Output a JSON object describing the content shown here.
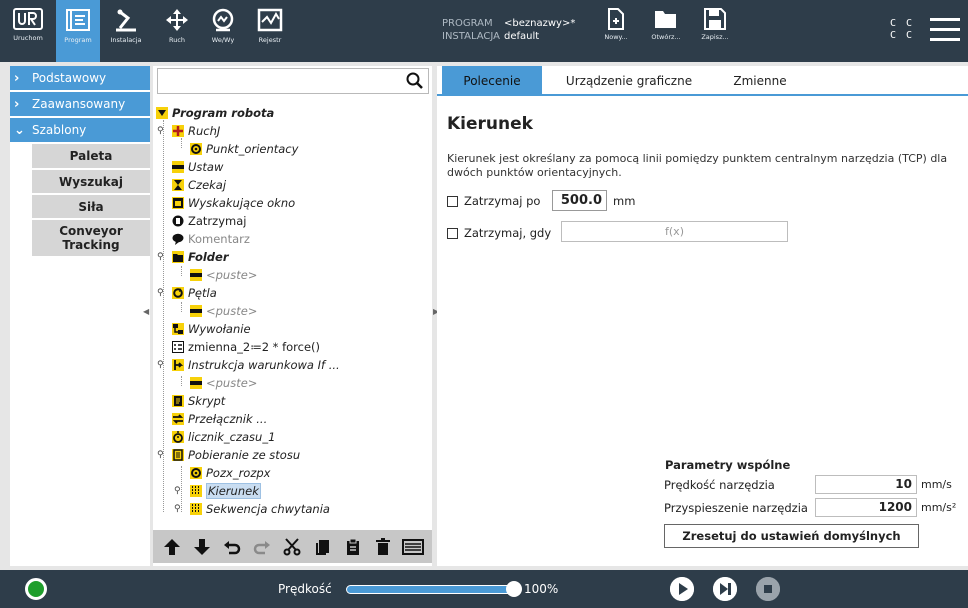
{
  "topbar": {
    "buttons": [
      {
        "label": "Uruchom",
        "icon": "ur-logo-icon"
      },
      {
        "label": "Program",
        "icon": "program-icon",
        "active": true
      },
      {
        "label": "Instalacja",
        "icon": "installation-icon"
      },
      {
        "label": "Ruch",
        "icon": "move-icon"
      },
      {
        "label": "We/Wy",
        "icon": "io-icon"
      },
      {
        "label": "Rejestr",
        "icon": "log-icon"
      }
    ],
    "program_key": "PROGRAM",
    "program_value": "<beznazwy>*",
    "installation_key": "INSTALACJA",
    "installation_value": "default",
    "file_buttons": [
      "Nowy...",
      "Otwórz...",
      "Zapisz..."
    ],
    "cc": [
      "C C",
      "C C"
    ]
  },
  "left": {
    "categories": [
      "Podstawowy",
      "Zaawansowany",
      "Szablony"
    ],
    "templates": [
      "Paleta",
      "Wyszukaj",
      "Siła",
      "Conveyor Tracking"
    ]
  },
  "tree": {
    "search_placeholder": "",
    "root": "Program robota",
    "items": [
      {
        "text": "RuchJ",
        "icon": "move-node-icon",
        "style": "italic"
      },
      {
        "text": "Punkt_orientacy",
        "icon": "waypoint-icon",
        "style": "italic"
      },
      {
        "text": "Ustaw",
        "icon": "set-icon",
        "style": "italic"
      },
      {
        "text": "Czekaj",
        "icon": "wait-icon",
        "style": "italic"
      },
      {
        "text": "Wyskakujące okno",
        "icon": "popup-icon",
        "style": "italic"
      },
      {
        "text": "Zatrzymaj",
        "icon": "halt-icon",
        "style": "normal"
      },
      {
        "text": "Komentarz",
        "icon": "comment-icon",
        "style": "gray"
      },
      {
        "text": "Folder",
        "icon": "folder-icon",
        "style": "bolditalic"
      },
      {
        "text": "<puste>",
        "icon": "empty-icon",
        "style": "grayitalic"
      },
      {
        "text": "Pętla",
        "icon": "loop-icon",
        "style": "italic"
      },
      {
        "text": "<puste>",
        "icon": "empty-icon",
        "style": "grayitalic"
      },
      {
        "text": "Wywołanie",
        "icon": "call-icon",
        "style": "italic"
      },
      {
        "text": "zmienna_2≔2 * force()",
        "icon": "assignment-icon",
        "style": "normal"
      },
      {
        "text": "Instrukcja warunkowa If ...",
        "icon": "if-icon",
        "style": "italic"
      },
      {
        "text": "<puste>",
        "icon": "empty-icon",
        "style": "grayitalic"
      },
      {
        "text": "Skrypt",
        "icon": "script-icon",
        "style": "italic"
      },
      {
        "text": "Przełącznik ...",
        "icon": "switch-icon",
        "style": "italic"
      },
      {
        "text": "licznik_czasu_1",
        "icon": "timer-icon",
        "style": "italic"
      },
      {
        "text": "Pobieranie ze stosu",
        "icon": "destack-icon",
        "style": "italic"
      },
      {
        "text": "Pozx_rozpx",
        "icon": "waypoint-icon",
        "style": "italic"
      },
      {
        "text": "Kierunek",
        "icon": "direction-icon",
        "style": "italic"
      },
      {
        "text": "Sekwencja chwytania",
        "icon": "sequence-icon",
        "style": "italic"
      }
    ]
  },
  "tabs": [
    "Polecenie",
    "Urządzenie graficzne",
    "Zmienne"
  ],
  "command": {
    "title": "Kierunek",
    "description": "Kierunek jest określany za pomocą linii pomiędzy punktem centralnym narzędzia (TCP) dla dwóch punktów orientacyjnych.",
    "stop_after_label": "Zatrzymaj po",
    "stop_after_value": "500.0",
    "stop_after_unit": "mm",
    "stop_when_label": "Zatrzymaj, gdy",
    "stop_when_expr": "f(x)"
  },
  "params": {
    "title": "Parametry wspólne",
    "tool_speed_label": "Prędkość narzędzia",
    "tool_speed_value": "10",
    "tool_speed_unit": "mm/s",
    "tool_accel_label": "Przyspieszenie narzędzia",
    "tool_accel_value": "1200",
    "tool_accel_unit": "mm/s²",
    "reset_label": "Zresetuj do ustawień domyślnych"
  },
  "bottom": {
    "speed_label": "Prędkość",
    "speed_percent": "100%",
    "speed_fraction": 1.0
  },
  "colors": {
    "accent": "#4a9ad6",
    "topbar": "#2e3d4a",
    "node_yellow": "#f7d10a",
    "power_green": "#1f9e2c"
  }
}
